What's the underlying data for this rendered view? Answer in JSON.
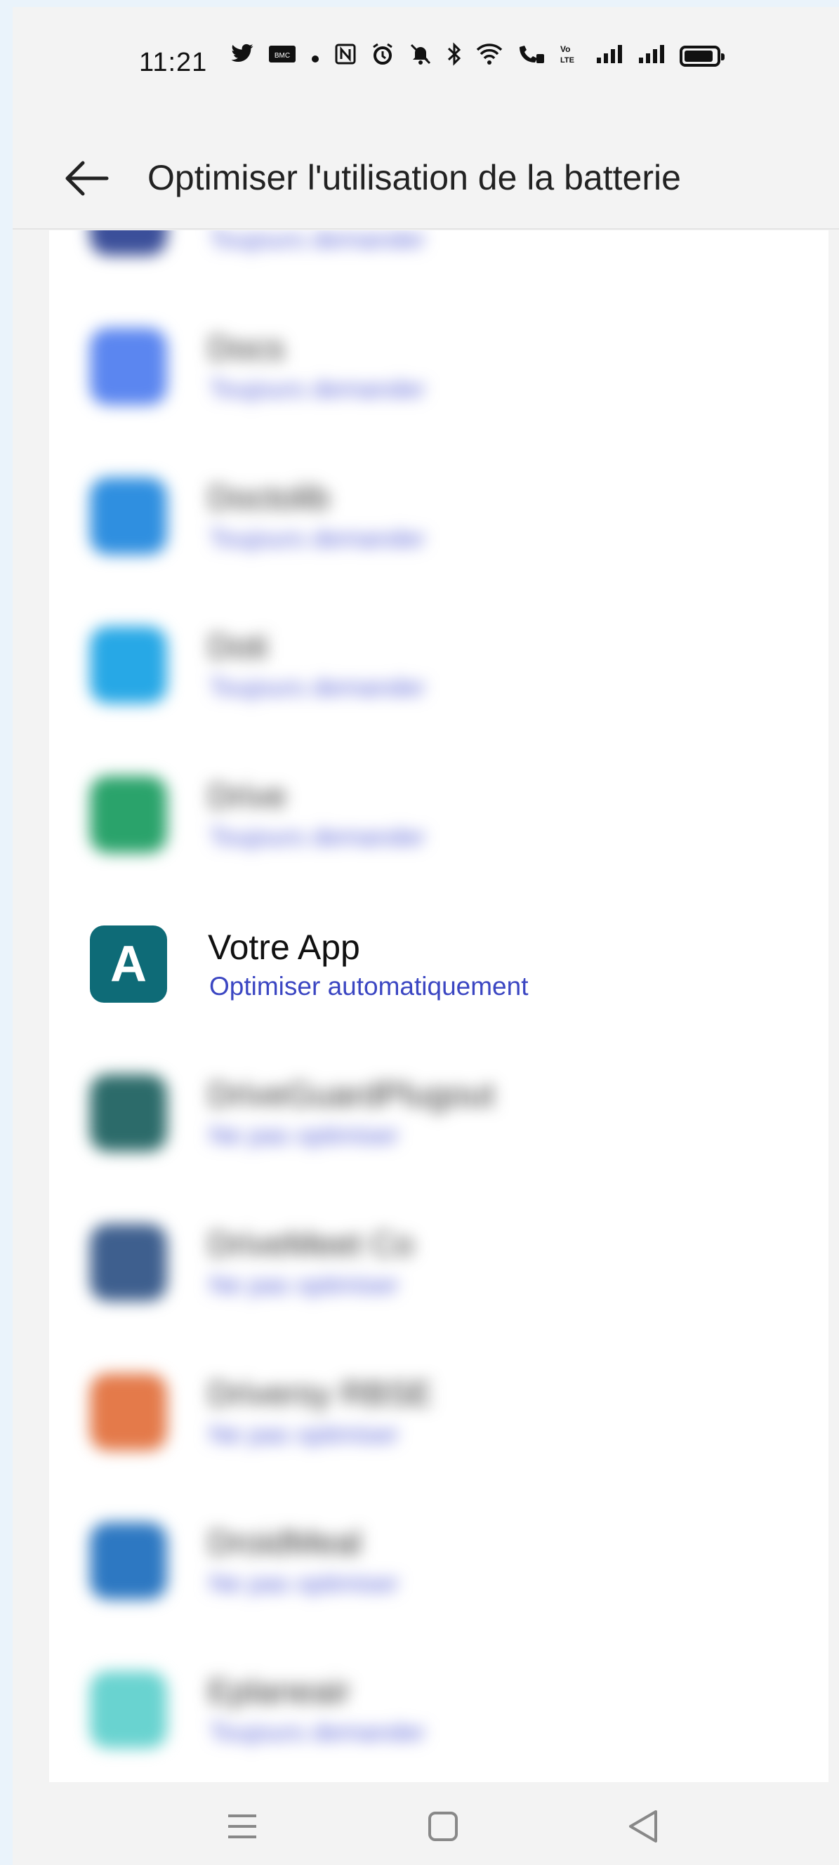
{
  "status_bar": {
    "time": "11:21",
    "icons": [
      "twitter-icon",
      "bmc-icon",
      "dot-icon",
      "nfc-icon",
      "alarm-icon",
      "mute-icon",
      "bluetooth-icon",
      "wifi-icon",
      "wifi-call-icon",
      "volte-icon",
      "signal-icon",
      "signal-icon",
      "battery-icon"
    ]
  },
  "header": {
    "title": "Optimiser l'utilisation de la batterie",
    "back_icon": "arrow-left-icon"
  },
  "apps": [
    {
      "name": "",
      "status": "Toujours demander",
      "icon_color": "#3b4f9a",
      "blurred": true
    },
    {
      "name": "Docs",
      "status": "Toujours demander",
      "icon_color": "#5b86f0",
      "blurred": true
    },
    {
      "name": "Doctolib",
      "status": "Toujours demander",
      "icon_color": "#2f8fe0",
      "blurred": true
    },
    {
      "name": "Doti",
      "status": "Toujours demander",
      "icon_color": "#27a8e6",
      "blurred": true
    },
    {
      "name": "Drive",
      "status": "Toujours demander",
      "icon_color": "#2aa36b",
      "blurred": true
    },
    {
      "name": "Votre App",
      "status": "Optimiser automatiquement",
      "icon_letter": "A",
      "icon_color": "#0e6b77",
      "blurred": false
    },
    {
      "name": "DriveGuardPlugout",
      "status": "Ne pas optimiser",
      "icon_color": "#2c6b6a",
      "blurred": true
    },
    {
      "name": "DriveMeet Co",
      "status": "Ne pas optimiser",
      "icon_color": "#3e5f8e",
      "blurred": true
    },
    {
      "name": "Driversy RBSE",
      "status": "Ne pas optimiser",
      "icon_color": "#e47a4a",
      "blurred": true
    },
    {
      "name": "DroidMeal",
      "status": "Ne pas optimiser",
      "icon_color": "#2d78c2",
      "blurred": true
    },
    {
      "name": "Eplaneair",
      "status": "Toujours demander",
      "icon_color": "#69d3d0",
      "blurred": true
    }
  ],
  "nav": {
    "menu_icon": "menu-icon",
    "home_icon": "home-icon",
    "back_icon": "back-triangle-icon"
  }
}
